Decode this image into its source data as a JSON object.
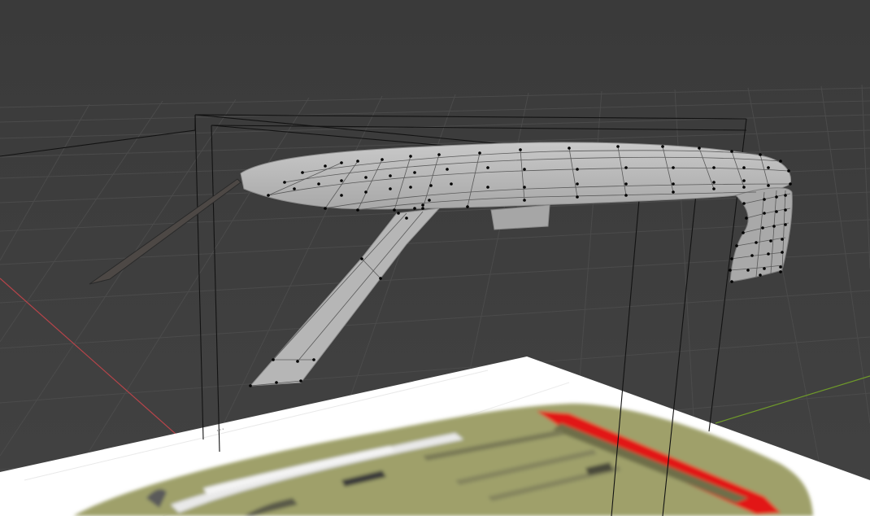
{
  "viewport": {
    "background_color": "#3d3d3d",
    "grid_color": "#4a4a4a",
    "x_axis_color": "#c0444a",
    "y_axis_color": "#6f9a2a",
    "wireframe_color": "#111111",
    "mesh_color": "#b8b8b8",
    "vertex_color": "#000000",
    "reference_image_label": "..."
  },
  "reference_image": {
    "background_color": "#ffffff",
    "body_color": "#9ea06a",
    "highlight_color": "#e01515",
    "stripe_color": "#e8e8e8"
  }
}
